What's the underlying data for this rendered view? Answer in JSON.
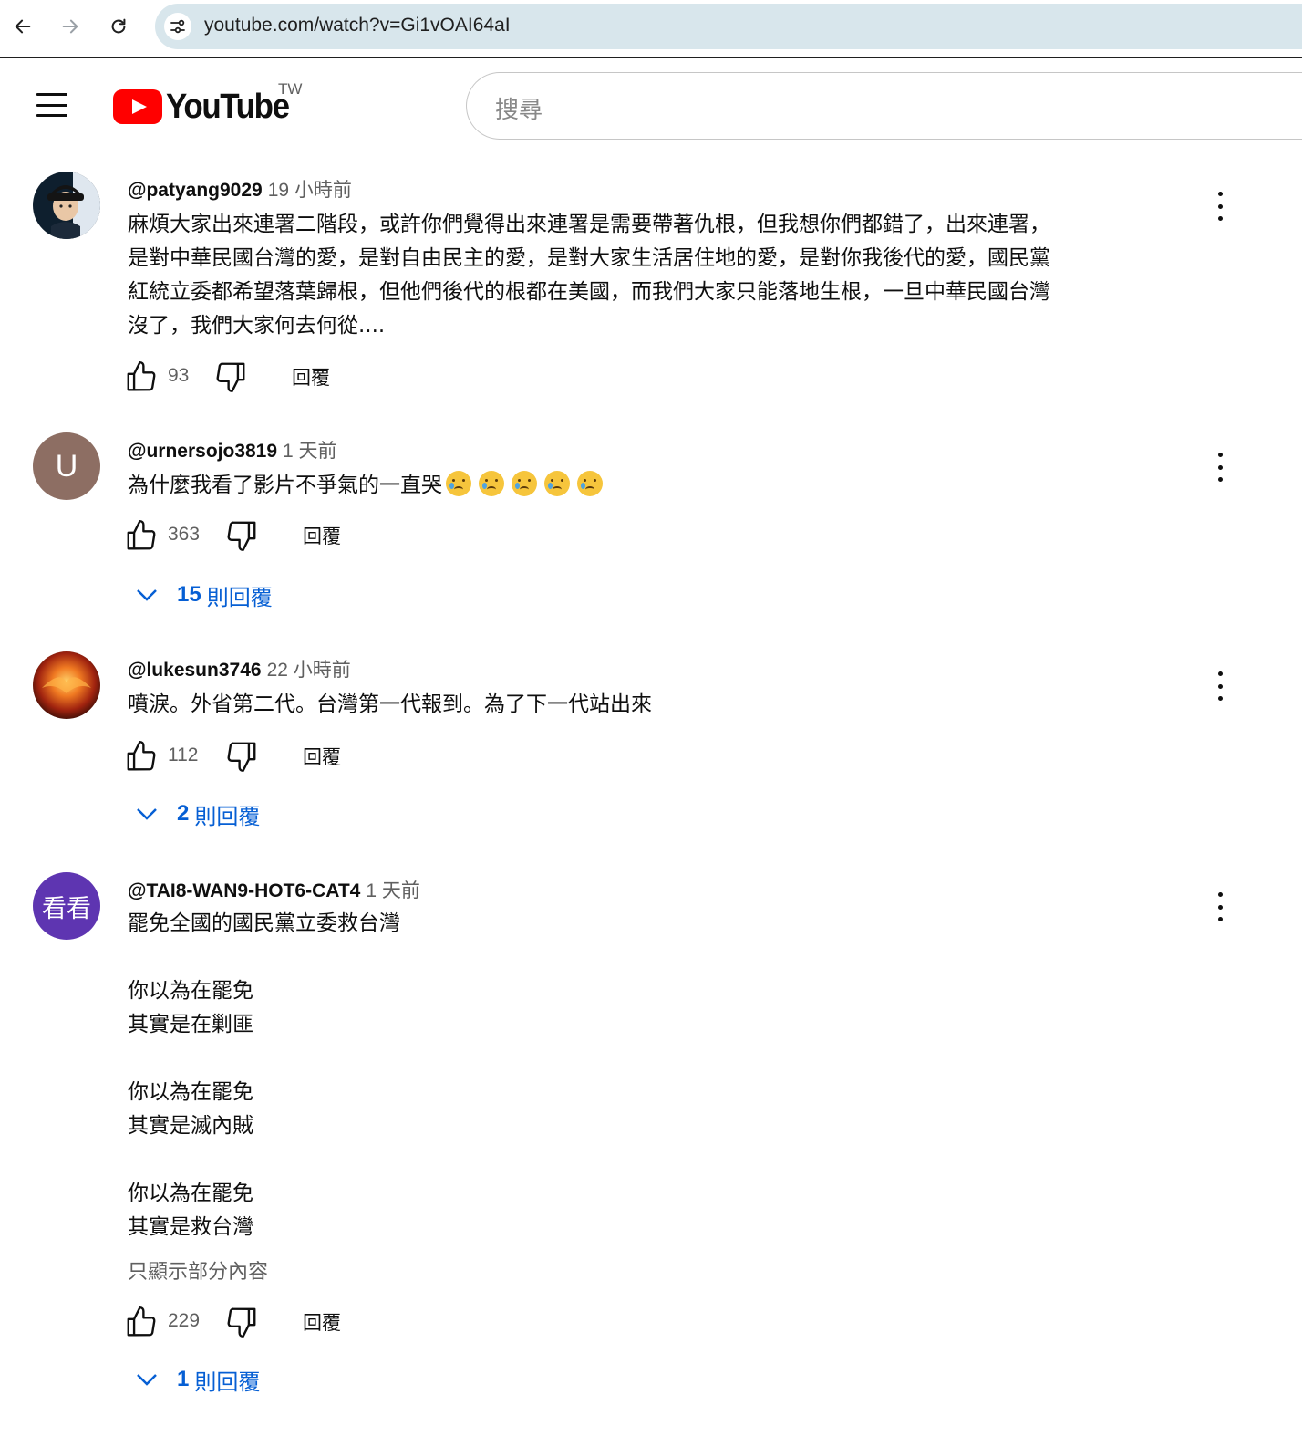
{
  "browser": {
    "url": "youtube.com/watch?v=Gi1vOAI64aI"
  },
  "header": {
    "logo_text": "YouTube",
    "region": "TW",
    "search_placeholder": "搜尋"
  },
  "comments": [
    {
      "author": "@patyang9029",
      "time": "19 小時前",
      "text": "麻煩大家出來連署二階段，或許你們覺得出來連署是需要帶著仇根，但我想你們都錯了，出來連署，\n是對中華民國台灣的愛，是對自由民主的愛，是對大家生活居住地的愛，是對你我後代的愛，國民黨\n紅統立委都希望落葉歸根，但他們後代的根都在美國，而我們大家只能落地生根，一旦中華民國台灣\n沒了，我們大家何去何從....",
      "likes": "93",
      "reply_label": "回覆"
    },
    {
      "author": "@urnersojo3819",
      "time": "1 天前",
      "avatar_letter": "U",
      "avatar_color": "#8d6e63",
      "text": "為什麼我看了影片不爭氣的一直哭",
      "emoji_name": "crying-face",
      "emoji_count": 5,
      "likes": "363",
      "reply_label": "回覆",
      "replies_count": "15",
      "replies_label": "則回覆"
    },
    {
      "author": "@lukesun3746",
      "time": "22 小時前",
      "text": "噴淚。外省第二代。台灣第一代報到。為了下一代站出來",
      "likes": "112",
      "reply_label": "回覆",
      "replies_count": "2",
      "replies_label": "則回覆"
    },
    {
      "author": "@TAI8-WAN9-HOT6-CAT4",
      "time": "1 天前",
      "avatar_letter": "看看",
      "avatar_color": "#5e35b1",
      "text": "罷免全國的國民黨立委救台灣\n\n你以為在罷免\n其實是在剿匪\n\n你以為在罷免\n其實是滅內賊\n\n你以為在罷免\n其實是救台灣",
      "read_more": "只顯示部分內容",
      "likes": "229",
      "reply_label": "回覆",
      "replies_count": "1",
      "replies_label": "則回覆"
    }
  ]
}
